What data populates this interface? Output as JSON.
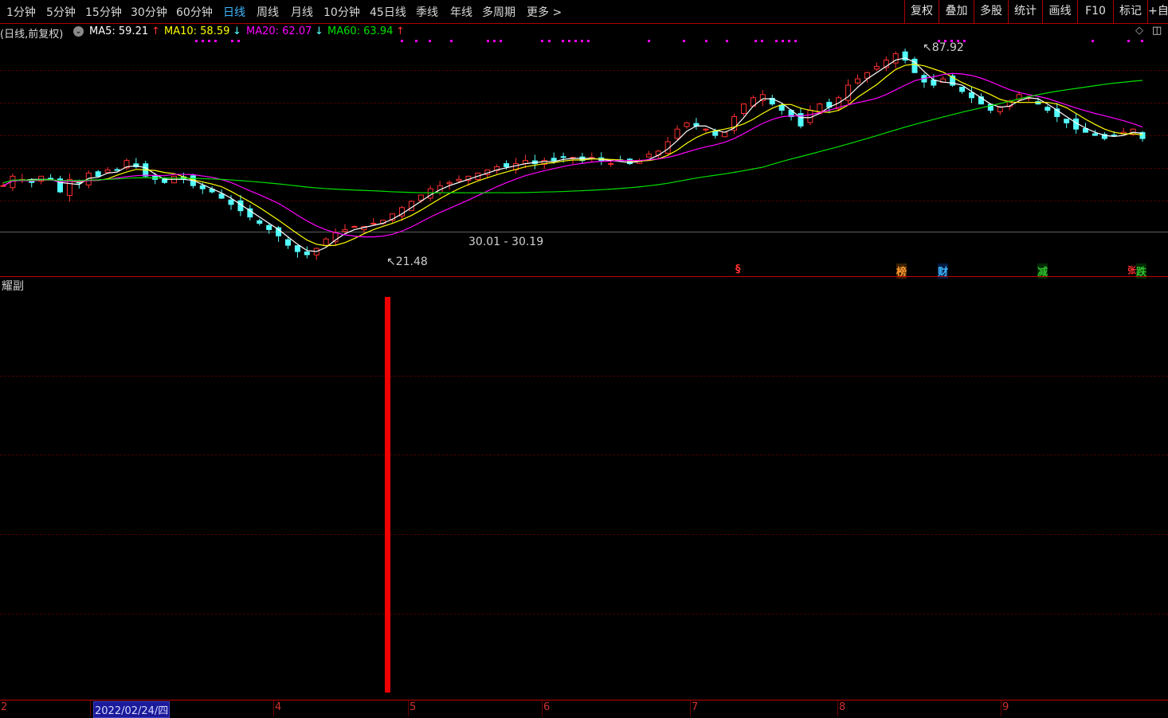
{
  "periods": [
    "1分钟",
    "5分钟",
    "15分钟",
    "30分钟",
    "60分钟",
    "日线",
    "周线",
    "月线",
    "10分钟",
    "45日线",
    "季线",
    "年线",
    "多周期",
    "更多 >"
  ],
  "active_period": "日线",
  "tools": [
    "复权",
    "叠加",
    "多股",
    "统计",
    "画线",
    "F10",
    "标记",
    "+自"
  ],
  "legend": {
    "label": "(日线,前复权)",
    "ma5": "MA5: 59.21",
    "ma5_arrow": "↑",
    "ma10": "MA10: 58.59",
    "ma10_arrow": "↓",
    "ma20": "MA20: 62.07",
    "ma20_arrow": "↓",
    "ma60": "MA60: 63.94",
    "ma60_arrow": "↑"
  },
  "annotations": {
    "high": "87.92",
    "low": "21.48",
    "range": "30.01 - 30.19"
  },
  "markers": [
    {
      "text": "§",
      "color": "#ff3030"
    },
    {
      "text": "榜",
      "color": "#ff9a30"
    },
    {
      "text": "财",
      "color": "#3fb7ff"
    },
    {
      "text": "减",
      "color": "#30c030"
    },
    {
      "text": "张",
      "color": "#ff3030"
    },
    {
      "text": "跌",
      "color": "#30c030"
    }
  ],
  "sub_panel_title": "耀副",
  "x_axis": [
    "2",
    "4",
    "5",
    "6",
    "7",
    "8",
    "9"
  ],
  "date_cursor": "2022/02/24/四",
  "colors": {
    "up": "#ff3030",
    "down": "#54ffff",
    "ma5": "#ffffff",
    "ma10": "#ffff00",
    "ma20": "#ff00ff",
    "ma60": "#00e000",
    "grid": "#4a0000",
    "panel_border": "#c00000"
  },
  "chart_data": {
    "type": "candlestick",
    "price_range": [
      21.48,
      87.92
    ],
    "ma_series": [
      {
        "name": "MA5",
        "value": 59.21
      },
      {
        "name": "MA10",
        "value": 58.59
      },
      {
        "name": "MA20",
        "value": 62.07
      },
      {
        "name": "MA60",
        "value": 63.94
      }
    ],
    "close_path": [
      44,
      47,
      46,
      45,
      47,
      46,
      42,
      46,
      45,
      48,
      47,
      49,
      49,
      52,
      50,
      47,
      46,
      45,
      47,
      46,
      44,
      43,
      42,
      40,
      38,
      36,
      34,
      32,
      30,
      28,
      25,
      23,
      22,
      24,
      27,
      29,
      30,
      31,
      31,
      32,
      33,
      35,
      37,
      39,
      41,
      43,
      44,
      45,
      46,
      47,
      48,
      49,
      50,
      50,
      51,
      52,
      51,
      52,
      52,
      53,
      53,
      52,
      53,
      52,
      51,
      52,
      51,
      52,
      54,
      55,
      58,
      62,
      64,
      63,
      62,
      60,
      61,
      66,
      70,
      72,
      73,
      70,
      68,
      66,
      63,
      68,
      70,
      69,
      72,
      76,
      78,
      80,
      82,
      84,
      86,
      84,
      80,
      77,
      76,
      78,
      76,
      74,
      72,
      70,
      68,
      69,
      71,
      73,
      72,
      70,
      68,
      66,
      64,
      62,
      61,
      60,
      59,
      60,
      61,
      62,
      59
    ]
  }
}
